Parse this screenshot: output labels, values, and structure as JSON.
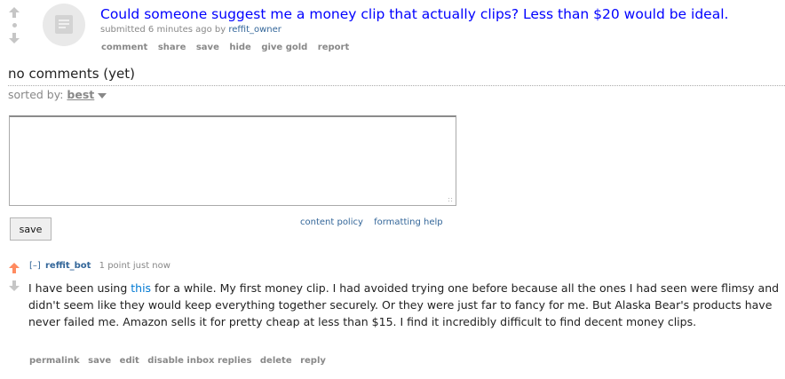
{
  "post": {
    "title": "Could someone suggest me a money clip that actually clips? Less than $20 would be ideal.",
    "submitted_prefix": "submitted 6 minutes ago by",
    "author": "reffit_owner",
    "buttons": [
      "comment",
      "share",
      "save",
      "hide",
      "give gold",
      "report"
    ]
  },
  "comments_area": {
    "heading": "no comments (yet)",
    "sorted_by_label": "sorted by:",
    "sort_value": "best",
    "save_label": "save",
    "content_policy": "content policy",
    "formatting_help": "formatting help"
  },
  "comment": {
    "collapse": "[–]",
    "author": "reffit_bot",
    "score_time": "1 point just now",
    "body_before": "I have been using ",
    "link_text": "this",
    "body_after": " for a while. My first money clip. I had avoided trying one before because all the ones I had seen were flimsy and didn't seem like they would keep everything together securely. Or they were just far to fancy for me. But Alaska Bear's products have never failed me. Amazon sells it for pretty cheap at less than $15. I find it incredibly difficult to find decent money clips.",
    "buttons": [
      "permalink",
      "save",
      "edit",
      "disable inbox replies",
      "delete",
      "reply"
    ]
  },
  "colors": {
    "upvoted_arrow": "#ff8b60",
    "neutral_arrow": "#c6c6c6",
    "title_link": "#0000ff",
    "author_link": "#336699"
  },
  "icons": [
    "upvote-arrow-icon",
    "downvote-arrow-icon",
    "self-post-thumbnail-icon",
    "dropdown-caret-icon",
    "resize-grip-icon"
  ]
}
